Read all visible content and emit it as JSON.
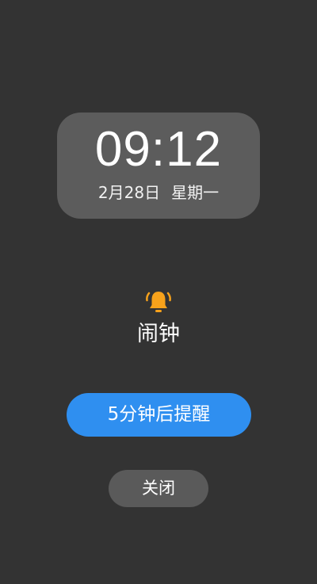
{
  "clock": {
    "time": "09:12",
    "date": "2月28日",
    "weekday": "星期一"
  },
  "alarm": {
    "icon": "bell-icon",
    "icon_color": "#f7a21b",
    "label": "闹钟"
  },
  "actions": {
    "snooze_label": "5分钟后提醒",
    "snooze_color": "#2f8ff0",
    "close_label": "关闭"
  },
  "colors": {
    "background": "#333333",
    "card": "#5c5c5c",
    "close_button": "#5a5a5a"
  }
}
